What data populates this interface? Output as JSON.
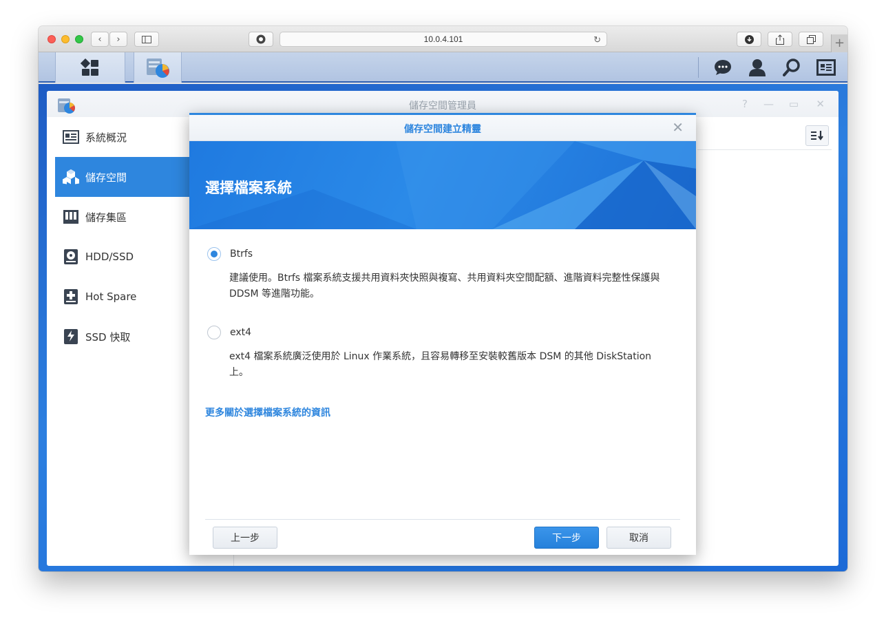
{
  "browser": {
    "url": "10.0.4.101",
    "new_tab_symbol": "+"
  },
  "colors": {
    "accent": "#2e86de",
    "desktop": "#1e5cc4"
  },
  "dsm": {
    "taskbar_icons": [
      "main-menu-icon",
      "storage-manager-icon"
    ],
    "tray_icons": [
      "chat-icon",
      "user-icon",
      "search-icon",
      "widgets-icon"
    ]
  },
  "app": {
    "title": "儲存空間管理員",
    "controls": [
      "?",
      "—",
      "▭",
      "✕"
    ],
    "sidebar": [
      {
        "label": "系統概況",
        "icon": "overview-icon"
      },
      {
        "label": "儲存空間",
        "icon": "volume-icon",
        "active": true
      },
      {
        "label": "儲存集區",
        "icon": "storage-pool-icon"
      },
      {
        "label": "HDD/SSD",
        "icon": "hdd-icon"
      },
      {
        "label": "Hot Spare",
        "icon": "hot-spare-icon"
      },
      {
        "label": "SSD 快取",
        "icon": "ssd-cache-icon"
      }
    ]
  },
  "wizard": {
    "title": "儲存空間建立精靈",
    "step_title": "選擇檔案系統",
    "options": [
      {
        "label": "Btrfs",
        "selected": true,
        "description": "建議使用。Btrfs 檔案系統支援共用資料夾快照與複寫、共用資料夾空間配額、進階資料完整性保護與 DDSM 等進階功能。"
      },
      {
        "label": "ext4",
        "selected": false,
        "description": "ext4 檔案系統廣泛使用於 Linux 作業系統，且容易轉移至安裝較舊版本 DSM 的其他 DiskStation 上。"
      }
    ],
    "more_link": "更多關於選擇檔案系統的資訊",
    "buttons": {
      "prev": "上一步",
      "next": "下一步",
      "cancel": "取消"
    }
  }
}
